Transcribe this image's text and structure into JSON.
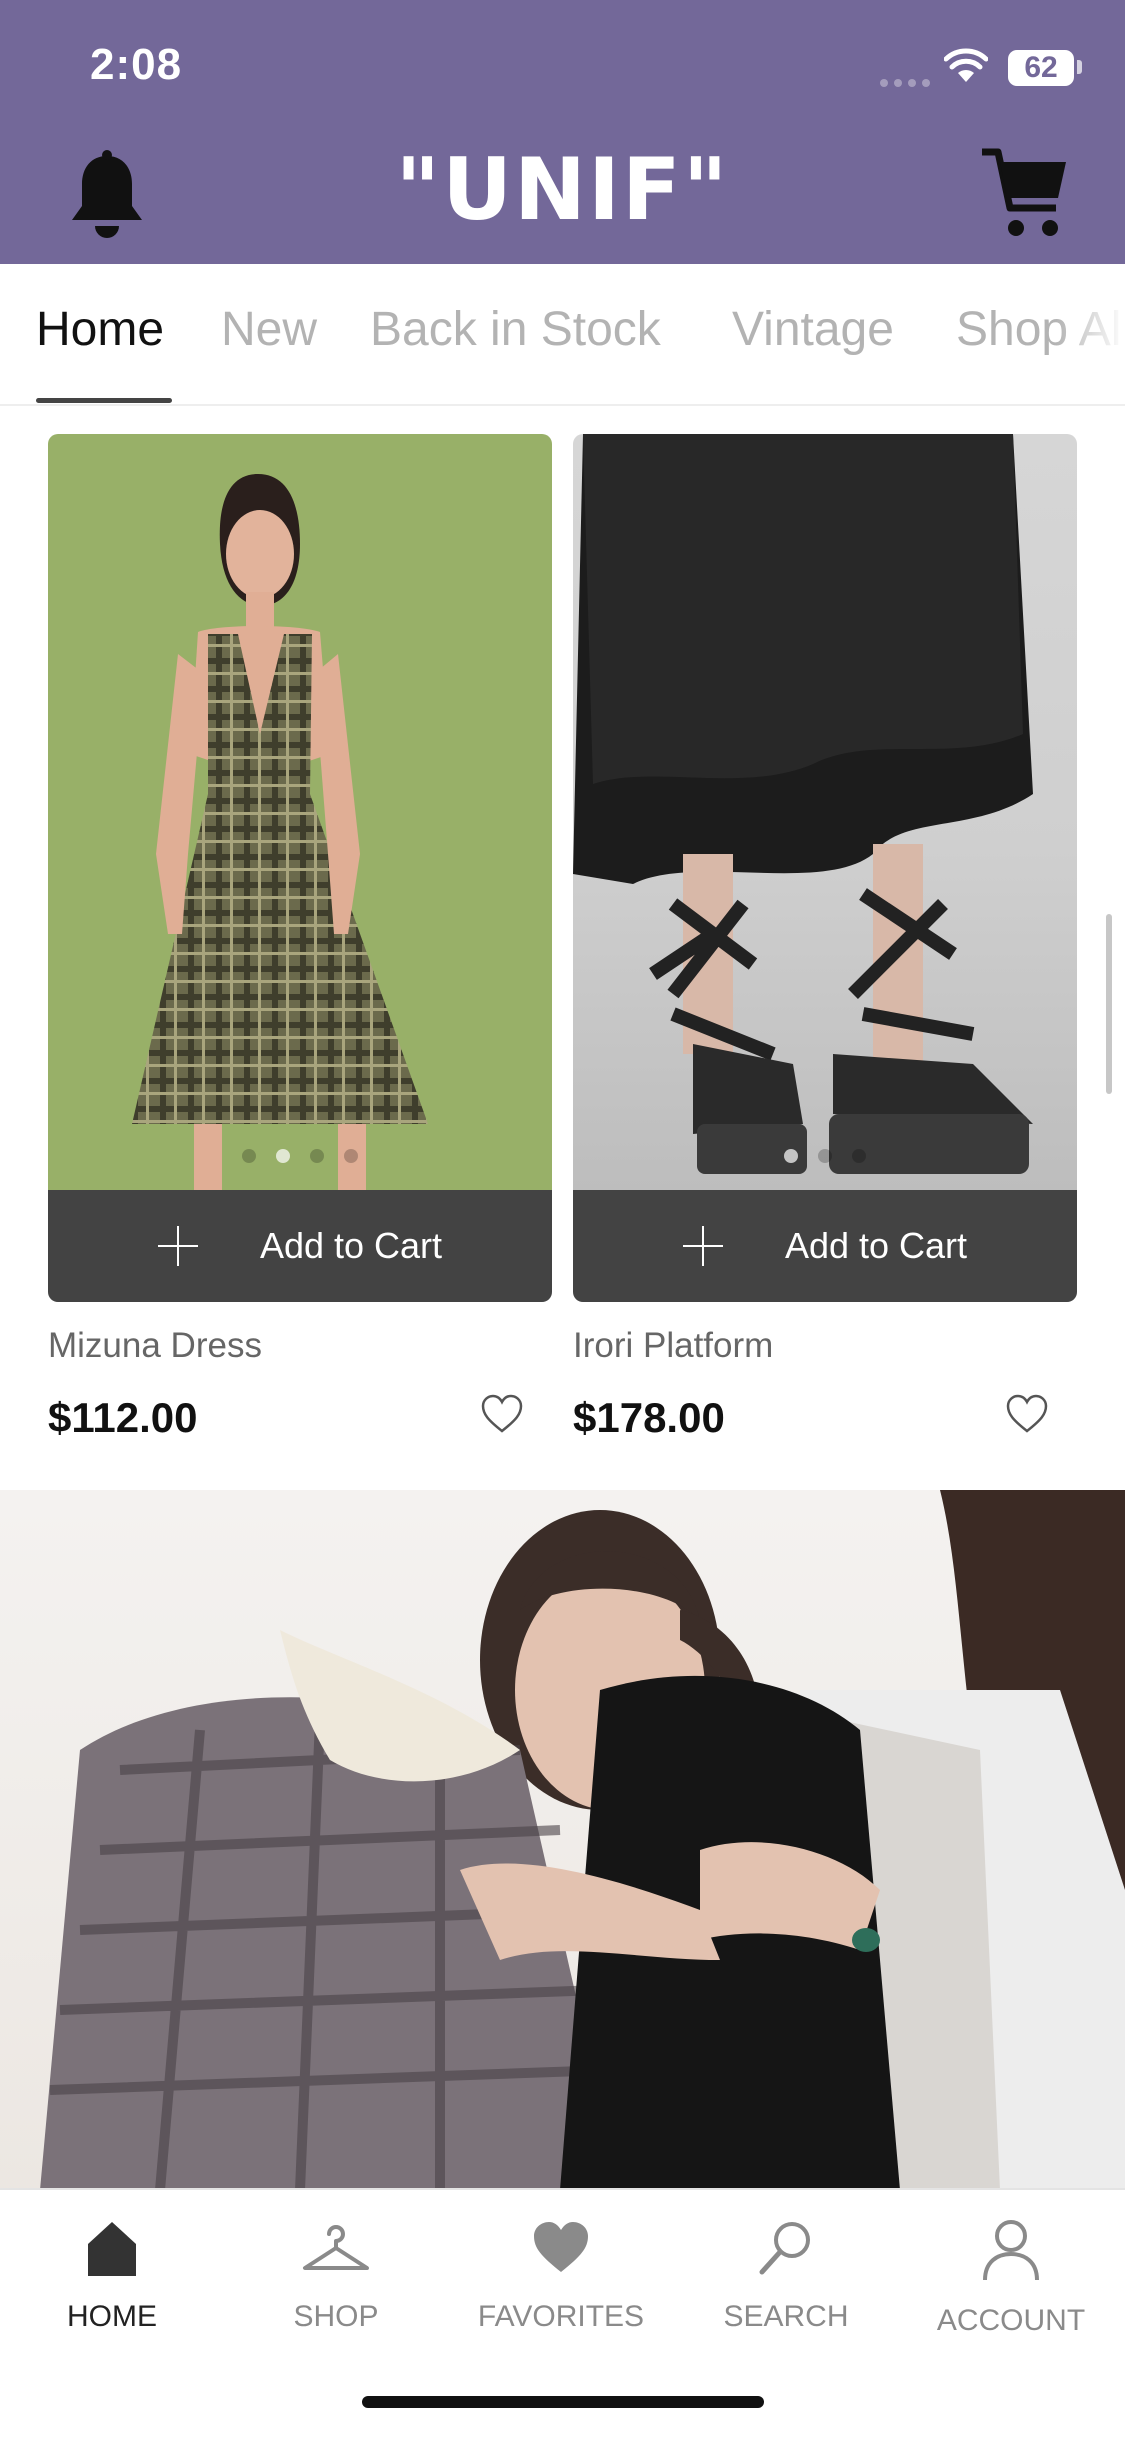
{
  "status_bar": {
    "time": "2:08",
    "battery": "62"
  },
  "header": {
    "logo": "\"UNIF\""
  },
  "tabs": [
    {
      "label": "Home",
      "active": true
    },
    {
      "label": "New",
      "active": false
    },
    {
      "label": "Back in Stock",
      "active": false
    },
    {
      "label": "Vintage",
      "active": false
    },
    {
      "label": "Shop All",
      "active": false
    }
  ],
  "products": [
    {
      "name": "Mizuna Dress",
      "price": "$112.00",
      "add_label": "Add to Cart"
    },
    {
      "name": "Irori Platform",
      "price": "$178.00",
      "add_label": "Add to Cart"
    }
  ],
  "bottom_nav": [
    {
      "label": "HOME",
      "icon": "home-icon",
      "active": true
    },
    {
      "label": "SHOP",
      "icon": "hanger-icon",
      "active": false
    },
    {
      "label": "FAVORITES",
      "icon": "heart-icon",
      "active": false
    },
    {
      "label": "SEARCH",
      "icon": "search-icon",
      "active": false
    },
    {
      "label": "ACCOUNT",
      "icon": "person-icon",
      "active": false
    }
  ],
  "colors": {
    "header_bg": "#736899",
    "button_bg": "#434343",
    "dress_bg": "#98b068"
  }
}
